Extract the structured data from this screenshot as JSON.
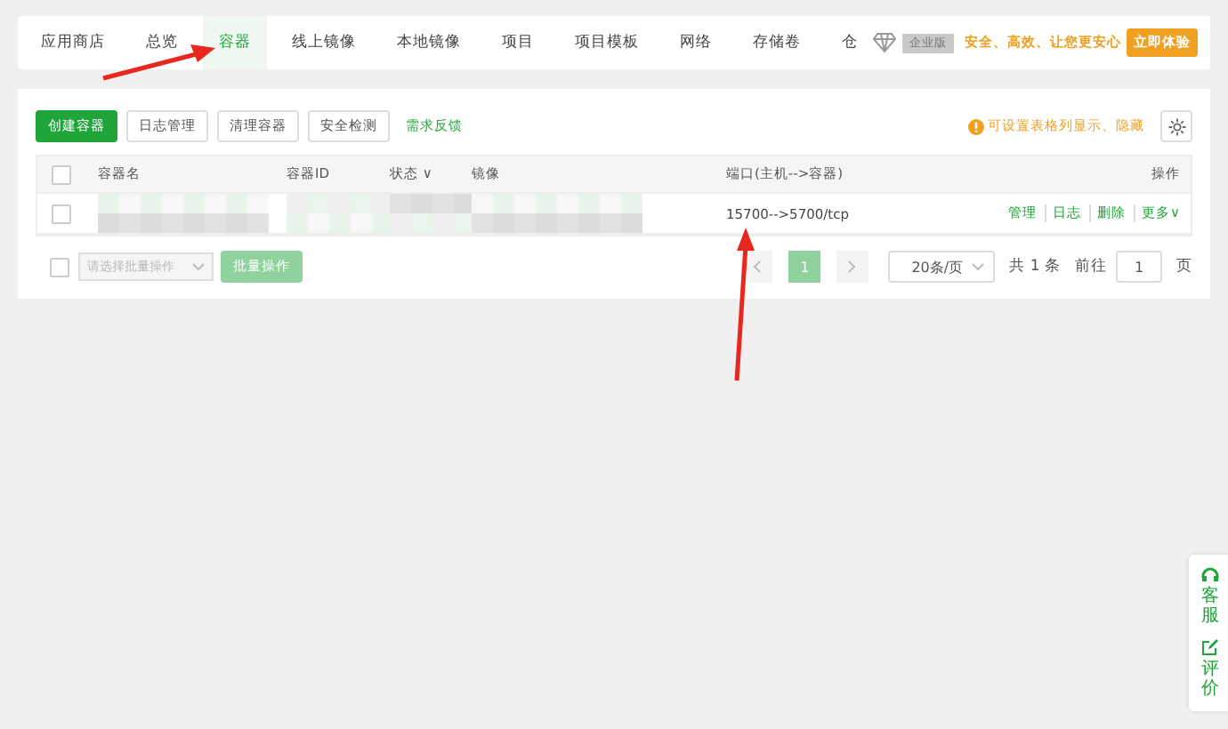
{
  "tabs": [
    {
      "label": "应用商店",
      "selected": false
    },
    {
      "label": "总览",
      "selected": false
    },
    {
      "label": "容器",
      "selected": true
    },
    {
      "label": "线上镜像",
      "selected": false
    },
    {
      "label": "本地镜像",
      "selected": false
    },
    {
      "label": "项目",
      "selected": false
    },
    {
      "label": "项目模板",
      "selected": false
    },
    {
      "label": "网络",
      "selected": false
    },
    {
      "label": "存储卷",
      "selected": false
    },
    {
      "label": "仓",
      "selected": false
    }
  ],
  "promo": {
    "badge": "企业版",
    "slogan": "安全、高效、让您更安心",
    "button": "立即体验"
  },
  "toolbar": {
    "buttons": [
      {
        "label": "创建容器",
        "kind": "primary"
      },
      {
        "label": "日志管理",
        "kind": "default"
      },
      {
        "label": "清理容器",
        "kind": "default"
      },
      {
        "label": "安全检测",
        "kind": "default"
      }
    ],
    "link": "需求反馈",
    "hint": "可设置表格列显示、隐藏"
  },
  "table": {
    "all_checked": false,
    "columns": [
      "容器名",
      "容器ID",
      "状态 ∨",
      "镜像",
      "端口(主机-->容器)",
      "操作"
    ],
    "rows": [
      {
        "checked": false,
        "cells": [
          {
            "kind": "redacted"
          },
          {
            "kind": "redacted"
          },
          {
            "kind": "redacted"
          },
          {
            "kind": "redacted"
          },
          {
            "kind": "text",
            "text": "15700-->5700/tcp"
          }
        ],
        "actions": [
          "管理",
          "日志",
          "删除",
          "更多∨"
        ]
      }
    ]
  },
  "footer": {
    "batch_checked": false,
    "select_placeholder": "请选择批量操作",
    "batch_button": "批量操作",
    "pages": [
      {
        "label": "1",
        "selected": true
      }
    ],
    "page_size": "20条/页",
    "total": "共 1 条",
    "goto_label": "前往",
    "goto_value": "1",
    "page_unit": "页"
  },
  "side_widget": [
    {
      "label": "客服",
      "kind": "service"
    },
    {
      "label": "评价",
      "kind": "review"
    }
  ]
}
